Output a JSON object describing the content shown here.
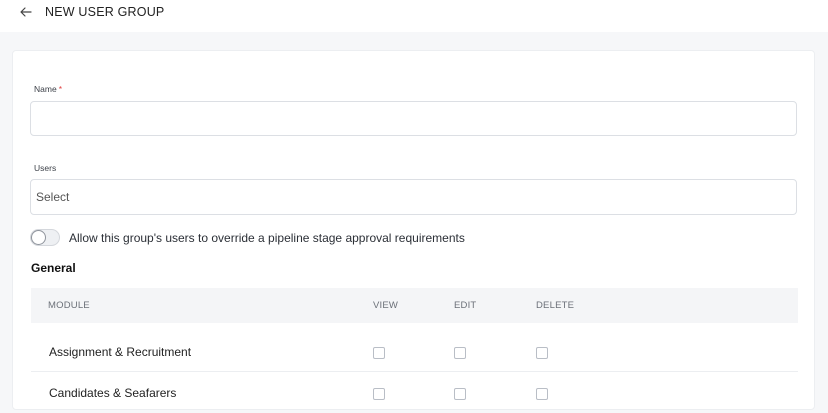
{
  "header": {
    "title": "NEW USER GROUP",
    "back_icon": "arrow-left-icon"
  },
  "form": {
    "name_label": "Name",
    "name_required_marker": "*",
    "name_value": "",
    "users_label": "Users",
    "users_select_value": "Select",
    "override_toggle_label": "Allow this group's users to override a pipeline stage approval requirements",
    "override_toggle_on": false
  },
  "permissions": {
    "section_title": "General",
    "columns": [
      "MODULE",
      "VIEW",
      "EDIT",
      "DELETE"
    ],
    "rows": [
      {
        "module": "Assignment & Recruitment",
        "view": false,
        "edit": false,
        "delete": false
      },
      {
        "module": "Candidates & Seafarers",
        "view": false,
        "edit": false,
        "delete": false
      }
    ]
  }
}
